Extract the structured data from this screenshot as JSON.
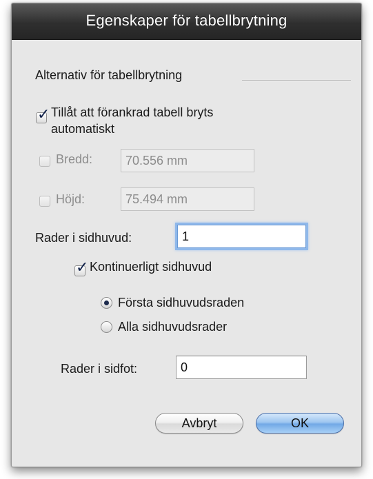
{
  "dialog": {
    "title": "Egenskaper för tabellbrytning",
    "section_label": "Alternativ för tabellbrytning",
    "auto_break": {
      "label_line1": "Tillåt att förankrad tabell bryts",
      "label_line2": "automatiskt",
      "checked": true
    },
    "width": {
      "label": "Bredd:",
      "value": "70.556 mm",
      "checked": false,
      "enabled": false
    },
    "height": {
      "label": "Höjd:",
      "value": "75.494 mm",
      "checked": false,
      "enabled": false
    },
    "header_rows": {
      "label": "Rader i sidhuvud:",
      "value": "1"
    },
    "continuous_header": {
      "label": "Kontinuerligt sidhuvud",
      "checked": true
    },
    "header_options": [
      {
        "label": "Första sidhuvudsraden",
        "selected": true
      },
      {
        "label": "Alla sidhuvudsrader",
        "selected": false
      }
    ],
    "footer_rows": {
      "label": "Rader i sidfot:",
      "value": "0"
    },
    "buttons": {
      "cancel": "Avbryt",
      "ok": "OK"
    }
  },
  "colors": {
    "titlebar": "#2f2f2f",
    "background": "#e7e7e7",
    "default_button": "#72a9e6",
    "focus_ring": "#8fb8ea"
  }
}
